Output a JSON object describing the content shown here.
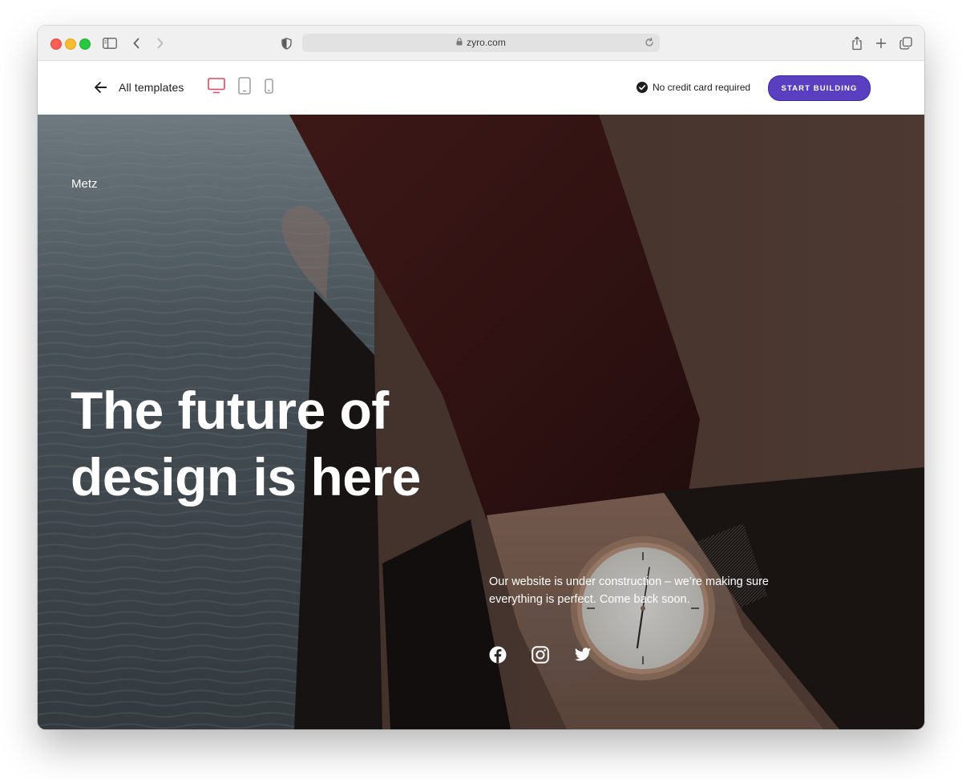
{
  "browser": {
    "url": "zyro.com"
  },
  "header": {
    "back_label": "All templates",
    "credit_text": "No credit card required",
    "cta_label": "START BUILDING",
    "active_device": "desktop",
    "accent_color": "#e4465f",
    "cta_color": "#5a3fc0"
  },
  "hero": {
    "brand": "Metz",
    "headline": "The future of design is here",
    "subtext": "Our website is under construction – we’re making sure everything is perfect. Come back soon.",
    "social_icons": [
      "facebook-icon",
      "instagram-icon",
      "twitter-icon"
    ]
  }
}
